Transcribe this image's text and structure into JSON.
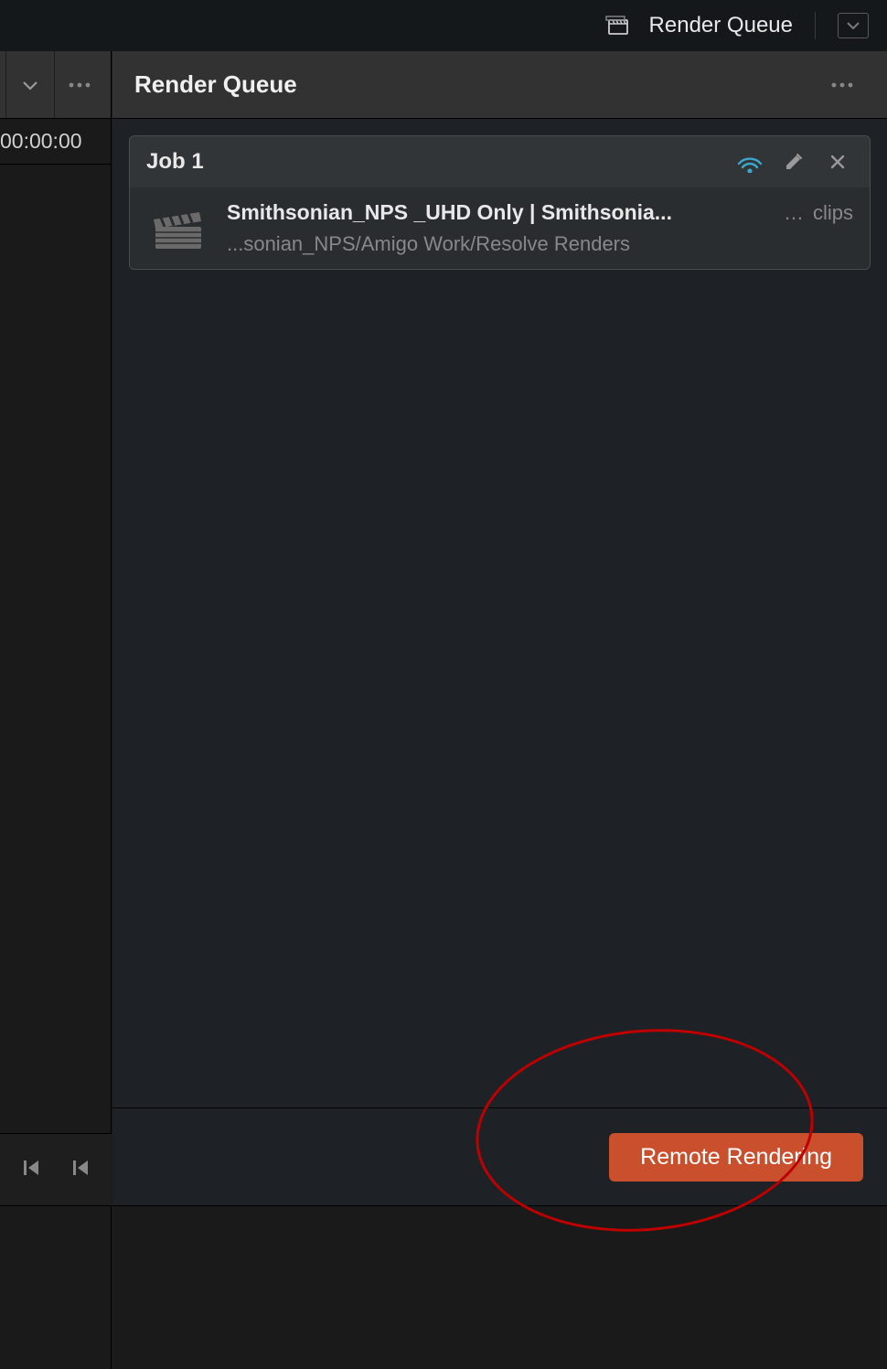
{
  "topbar": {
    "label": "Render Queue"
  },
  "left": {
    "timecode": "00:00:00"
  },
  "panel": {
    "title": "Render Queue"
  },
  "job": {
    "title": "Job 1",
    "line1": "Smithsonian_NPS _UHD Only | Smithsonia...",
    "clips_suffix": "clips",
    "line2": "...sonian_NPS/Amigo Work/Resolve Renders"
  },
  "button": {
    "render": "Remote Rendering"
  }
}
